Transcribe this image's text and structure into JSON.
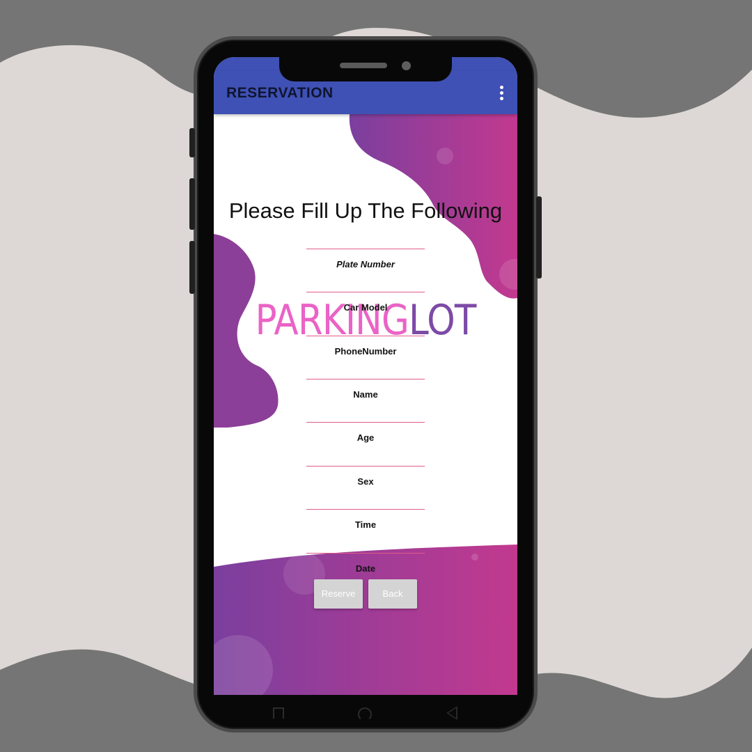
{
  "app": {
    "title": "RESERVATION",
    "menu_icon": "overflow-menu-icon"
  },
  "form": {
    "heading": "Please Fill Up The Following",
    "fields": [
      {
        "label": "Plate Number"
      },
      {
        "label": "Car Model"
      },
      {
        "label": "PhoneNumber"
      },
      {
        "label": "Name"
      },
      {
        "label": "Age"
      },
      {
        "label": "Sex"
      },
      {
        "label": "Time"
      },
      {
        "label": "Date"
      }
    ],
    "underline_color": "#e05a8a"
  },
  "logo": {
    "part1": "PARKING",
    "part2": "LOT",
    "part1_color": "#ea63c6",
    "part2_color": "#7d4aa6"
  },
  "actions": {
    "reserve_label": "Reserve",
    "back_label": "Back"
  },
  "theme": {
    "appbar_color": "#3f51b5",
    "gradient_start": "#7b3f9e",
    "gradient_end": "#c2398f",
    "button_color": "#d4d4d4"
  },
  "navigation": {
    "icons": [
      "recent-apps-icon",
      "home-icon",
      "back-icon"
    ]
  }
}
